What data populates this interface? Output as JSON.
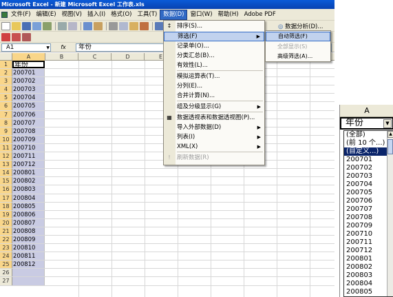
{
  "window": {
    "title": "Microsoft Excel - 新建 Microsoft Excel 工作表.xls"
  },
  "menubar": {
    "items": [
      "文件(F)",
      "编辑(E)",
      "视图(V)",
      "插入(I)",
      "格式(O)",
      "工具(T)",
      "数据(D)",
      "窗口(W)",
      "帮助(H)",
      "Adobe PDF"
    ],
    "active_index": 6
  },
  "toolbar": {
    "data_analysis": "数据分析(D)..."
  },
  "formula_bar": {
    "name_box": "A1",
    "fx": "fx",
    "content": "年份"
  },
  "grid": {
    "columns": [
      "A",
      "B",
      "C",
      "D",
      "E"
    ],
    "row_numbers": [
      "1",
      "2",
      "3",
      "4",
      "5",
      "6",
      "7",
      "8",
      "9",
      "10",
      "11",
      "12",
      "13",
      "14",
      "15",
      "16",
      "17",
      "18",
      "19",
      "20",
      "21",
      "22",
      "23",
      "24",
      "25",
      "26",
      "27"
    ],
    "column_a": [
      "年份",
      "200701",
      "200702",
      "200703",
      "200704",
      "200705",
      "200706",
      "200707",
      "200708",
      "200709",
      "200710",
      "200711",
      "200712",
      "200801",
      "200802",
      "200803",
      "200804",
      "200805",
      "200806",
      "200807",
      "200808",
      "200809",
      "200810",
      "200811",
      "200812",
      "",
      ""
    ]
  },
  "data_menu": {
    "items": [
      {
        "label": "排序(S)...",
        "icon": "sort-icon",
        "submenu": false,
        "disabled": false
      },
      {
        "label": "筛选(F)",
        "submenu": true,
        "highlighted": true,
        "disabled": false
      },
      {
        "label": "记录单(O)...",
        "submenu": false,
        "disabled": false
      },
      {
        "label": "分类汇总(B)...",
        "submenu": false,
        "disabled": false
      },
      {
        "label": "有效性(L)...",
        "submenu": false,
        "disabled": false
      },
      {
        "label": "模拟运算表(T)...",
        "submenu": false,
        "disabled": false
      },
      {
        "label": "分列(E)...",
        "submenu": false,
        "disabled": false
      },
      {
        "label": "合并计算(N)...",
        "submenu": false,
        "disabled": false
      },
      {
        "label": "组及分级显示(G)",
        "submenu": true,
        "disabled": false
      },
      {
        "label": "数据透视表和数据透视图(P)...",
        "icon": "pivot-icon",
        "submenu": false,
        "disabled": false
      },
      {
        "label": "导入外部数据(D)",
        "submenu": true,
        "disabled": false
      },
      {
        "label": "列表(I)",
        "submenu": true,
        "disabled": false
      },
      {
        "label": "XML(X)",
        "submenu": true,
        "disabled": false
      },
      {
        "label": "刷新数据(R)",
        "icon": "refresh-icon",
        "submenu": false,
        "disabled": true
      }
    ]
  },
  "filter_submenu": {
    "items": [
      {
        "label": "自动筛选(F)",
        "highlighted": true,
        "disabled": false
      },
      {
        "label": "全部显示(S)",
        "disabled": true
      },
      {
        "label": "高级筛选(A)...",
        "disabled": false
      }
    ]
  },
  "zoom_panel": {
    "column_header": "A",
    "cell_value": "年份",
    "list_items": [
      "(全部)",
      "(前 10 个...)",
      "(自定义...)",
      "200701",
      "200702",
      "200703",
      "200704",
      "200705",
      "200706",
      "200707",
      "200708",
      "200709",
      "200710",
      "200711",
      "200712",
      "200801",
      "200802",
      "200803",
      "200804",
      "200805"
    ],
    "highlighted_index": 2
  },
  "colors": {
    "titlebar": "#0a5bd8",
    "menu_highlight": "#316ac5",
    "selection_fill": "#c9cbe3",
    "chrome": "#ece9d8"
  }
}
